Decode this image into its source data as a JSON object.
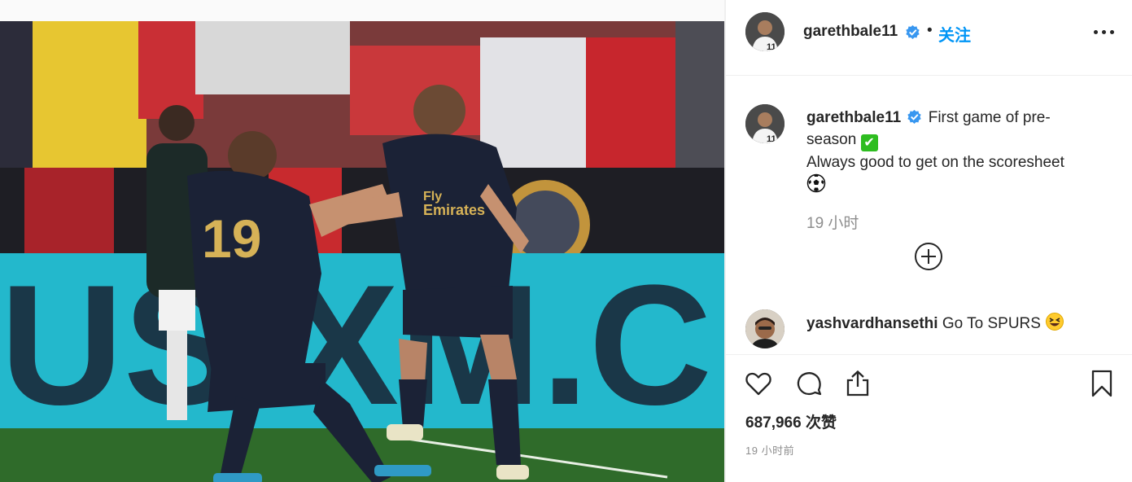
{
  "post": {
    "media_alt": "Two soccer players in dark blue kits exchanging a handshake on the pitch in front of a crowd",
    "jersey_number": "19",
    "shirt_sponsor_line1": "Fly",
    "shirt_sponsor_line2": "Emirates",
    "board_text": "US XM.C"
  },
  "header": {
    "username": "garethbale11",
    "separator": "•",
    "follow_label": "关注",
    "more_icon": "more-horizontal-icon"
  },
  "caption": {
    "username": "garethbale11",
    "text_line1": "First game of pre-",
    "text_line2": "season",
    "text_line3": "Always good to get on the scoresheet",
    "time": "19 小时",
    "check_emoji": "✔"
  },
  "comment": {
    "username": "yashvardhansethi",
    "text": "Go To SPURS"
  },
  "actions": {
    "likes": "687,966 次赞",
    "ago": "19 小时前"
  },
  "colors": {
    "accent": "#0095f6",
    "verified": "#3897f0",
    "muted": "#8e8e8e",
    "kit": "#1b2236",
    "board": "#1fb4c8"
  }
}
